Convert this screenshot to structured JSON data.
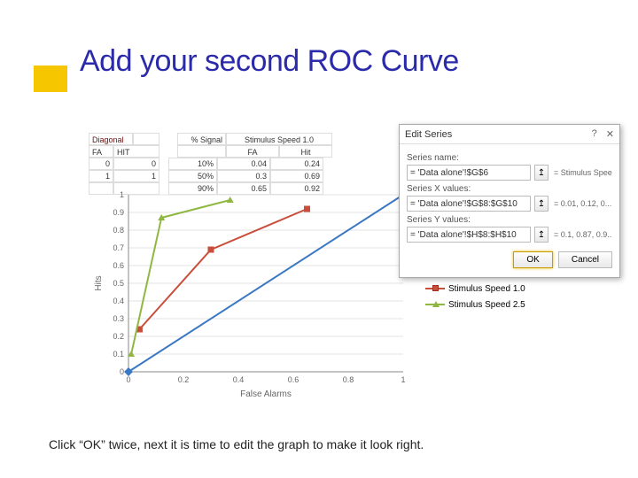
{
  "title": "Add your second ROC Curve",
  "footer": "Click “OK” twice, next it is time to edit the graph to make it look right.",
  "data_strip": {
    "headers": {
      "h1": "Diagonal",
      "fa": "FA",
      "hit": "HIT",
      "psig": "% Signal",
      "grp1": "Stimulus Speed 1.0",
      "fa2": "FA",
      "hit2": "Hit"
    },
    "rows": [
      {
        "fa": "0",
        "hit": "0",
        "psig": "10%",
        "s1fa": "0.04",
        "s1hit": "0.24"
      },
      {
        "fa": "1",
        "hit": "1",
        "psig": "50%",
        "s1fa": "0.3",
        "s1hit": "0.69"
      },
      {
        "fa": "",
        "hit": "",
        "psig": "90%",
        "s1fa": "0.65",
        "s1hit": "0.92"
      }
    ]
  },
  "dialog": {
    "title": "Edit Series",
    "lbl_name": "Series name:",
    "val_name": "= 'Data alone'!$G$6",
    "prev_name": "= Stimulus Speed...",
    "lbl_x": "Series X values:",
    "val_x": "= 'Data alone'!$G$8:$G$10",
    "prev_x": "= 0.01, 0.12, 0...",
    "lbl_y": "Series Y values:",
    "val_y": "= 'Data alone'!$H$8:$H$10",
    "prev_y": "= 0.1, 0.87, 0.9...",
    "ok": "OK",
    "cancel": "Cancel"
  },
  "chart_data": {
    "type": "line",
    "xlabel": "False Alarms",
    "ylabel": "Hits",
    "xlim": [
      0,
      1
    ],
    "ylim": [
      0,
      1
    ],
    "xticks": [
      0,
      0.2,
      0.4,
      0.6,
      0.8,
      1
    ],
    "yticks": [
      0,
      0.1,
      0.2,
      0.3,
      0.4,
      0.5,
      0.6,
      0.7,
      0.8,
      0.9,
      1
    ],
    "series": [
      {
        "name": "Diagonal",
        "color": "#3b78c4",
        "x": [
          0,
          1
        ],
        "y": [
          0,
          1
        ]
      },
      {
        "name": "Stimulus Speed 1.0",
        "color": "#c84d3a",
        "x": [
          0.04,
          0.3,
          0.65
        ],
        "y": [
          0.24,
          0.69,
          0.92
        ]
      },
      {
        "name": "Stimulus Speed 2.5",
        "color": "#8fb742",
        "x": [
          0.01,
          0.12,
          0.37
        ],
        "y": [
          0.1,
          0.87,
          0.97
        ]
      }
    ]
  },
  "legend": {
    "items": [
      "Diagonal",
      "Stimulus Speed 1.0",
      "Stimulus Speed 2.5"
    ]
  }
}
